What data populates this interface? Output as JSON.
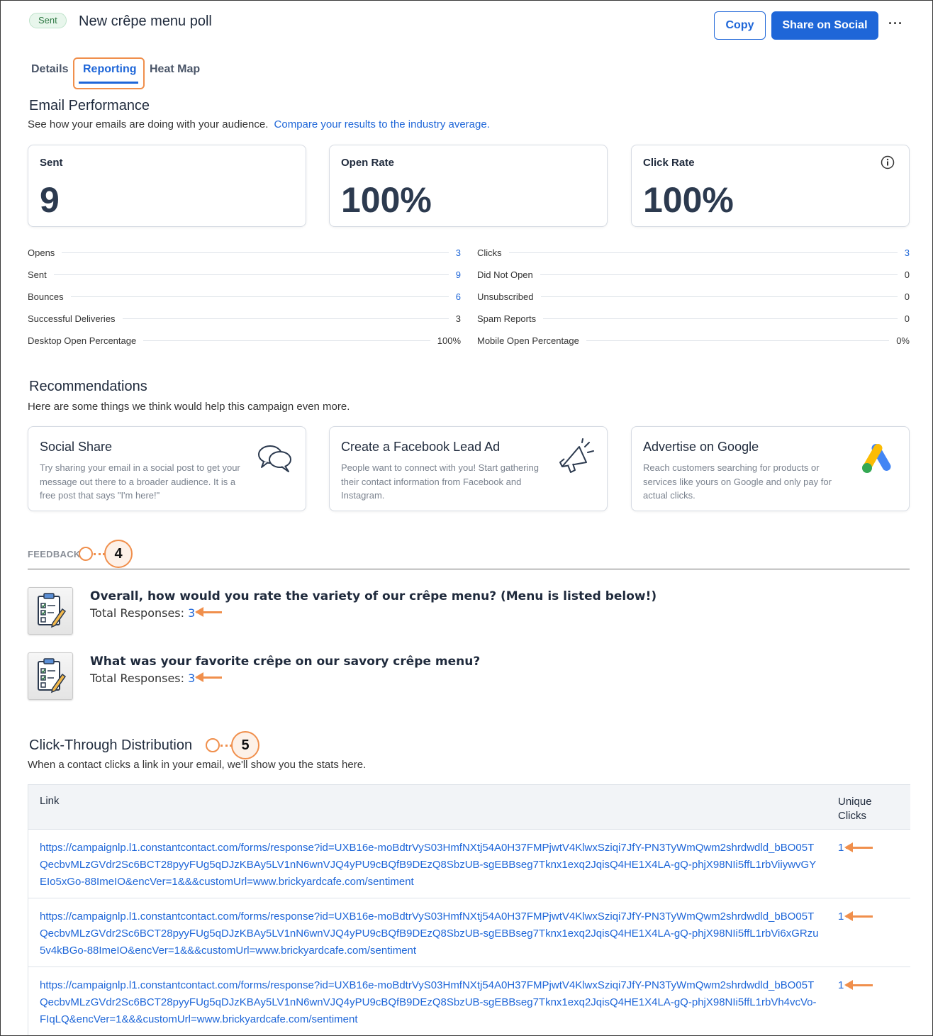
{
  "header": {
    "status_badge": "Sent",
    "title": "New crêpe menu poll",
    "copy_label": "Copy",
    "share_label": "Share on Social",
    "more_label": "···"
  },
  "tabs": [
    {
      "label": "Details"
    },
    {
      "label": "Reporting"
    },
    {
      "label": "Heat Map"
    }
  ],
  "performance": {
    "title": "Email Performance",
    "subtitle": "See how your emails are doing with your audience.",
    "compare_link": "Compare your results to the industry average.",
    "cards": [
      {
        "label": "Sent",
        "value": "9"
      },
      {
        "label": "Open Rate",
        "value": "100%"
      },
      {
        "label": "Click Rate",
        "value": "100%",
        "icon": "info-icon"
      }
    ],
    "left_stats": [
      {
        "name": "Opens",
        "value": "3",
        "link": true
      },
      {
        "name": "Sent",
        "value": "9",
        "link": true
      },
      {
        "name": "Bounces",
        "value": "6",
        "link": true
      },
      {
        "name": "Successful Deliveries",
        "value": "3",
        "link": false
      },
      {
        "name": "Desktop Open Percentage",
        "value": "100%",
        "link": false
      }
    ],
    "right_stats": [
      {
        "name": "Clicks",
        "value": "3",
        "link": true
      },
      {
        "name": "Did Not Open",
        "value": "0",
        "link": false
      },
      {
        "name": "Unsubscribed",
        "value": "0",
        "link": false
      },
      {
        "name": "Spam Reports",
        "value": "0",
        "link": false
      },
      {
        "name": "Mobile Open Percentage",
        "value": "0%",
        "link": false
      }
    ]
  },
  "recommendations": {
    "title": "Recommendations",
    "subtitle": "Here are some things we think would help this campaign even more.",
    "cards": [
      {
        "title": "Social Share",
        "desc": "Try sharing your email in a social post to get your message out there to a broader audience. It is a free post that says \"I'm here!\"",
        "icon": "chat-bubbles-icon"
      },
      {
        "title": "Create a Facebook Lead Ad",
        "desc": "People want to connect with you! Start gathering their contact information from Facebook and Instagram.",
        "icon": "megaphone-icon"
      },
      {
        "title": "Advertise on Google",
        "desc": "Reach customers searching for products or services like yours on Google and only pay for actual clicks.",
        "icon": "google-ads-icon"
      }
    ]
  },
  "feedback": {
    "label": "FEEDBACK",
    "callout": "4",
    "questions": [
      {
        "text": "Overall, how would you rate the variety of our crêpe menu? (Menu is listed below!)",
        "responses_label": "Total Responses:",
        "responses": "3"
      },
      {
        "text": "What was your favorite crêpe on our savory crêpe menu?",
        "responses_label": "Total Responses:",
        "responses": "3"
      }
    ]
  },
  "clickthrough": {
    "title": "Click-Through Distribution",
    "callout": "5",
    "subtitle": "When a contact clicks a link in your email, we'll show you the stats here.",
    "col_link": "Link",
    "col_clicks": "Unique Clicks",
    "rows": [
      {
        "url": "https://campaignlp.l1.constantcontact.com/forms/response?id=UXB16e-moBdtrVyS03HmfNXtj54A0H37FMPjwtV4KlwxSziqi7JfY-PN3TyWmQwm2shrdwdld_bBO05TQecbvMLzGVdr2Sc6BCT28pyyFUg5qDJzKBAy5LV1nN6wnVJQ4yPU9cBQfB9DEzQ8SbzUB-sgEBBseg7Tknx1exq2JqisQ4HE1X4LA-gQ-phjX98NIi5ffL1rbViiywvGYEIo5xGo-88ImeIO&encVer=1&&&customUrl=www.brickyardcafe.com/sentiment",
        "clicks": "1"
      },
      {
        "url": "https://campaignlp.l1.constantcontact.com/forms/response?id=UXB16e-moBdtrVyS03HmfNXtj54A0H37FMPjwtV4KlwxSziqi7JfY-PN3TyWmQwm2shrdwdld_bBO05TQecbvMLzGVdr2Sc6BCT28pyyFUg5qDJzKBAy5LV1nN6wnVJQ4yPU9cBQfB9DEzQ8SbzUB-sgEBBseg7Tknx1exq2JqisQ4HE1X4LA-gQ-phjX98NIi5ffL1rbVi6xGRzu5v4kBGo-88ImeIO&encVer=1&&&customUrl=www.brickyardcafe.com/sentiment",
        "clicks": "1"
      },
      {
        "url": "https://campaignlp.l1.constantcontact.com/forms/response?id=UXB16e-moBdtrVyS03HmfNXtj54A0H37FMPjwtV4KlwxSziqi7JfY-PN3TyWmQwm2shrdwdld_bBO05TQecbvMLzGVdr2Sc6BCT28pyyFUg5qDJzKBAy5LV1nN6wnVJQ4yPU9cBQfB9DEzQ8SbzUB-sgEBBseg7Tknx1exq2JqisQ4HE1X4LA-gQ-phjX98NIi5ffL1rbVh4vcVo-FIqLQ&encVer=1&&&customUrl=www.brickyardcafe.com/sentiment",
        "clicks": "1"
      }
    ]
  },
  "colors": {
    "primary": "#1e66d8",
    "callout": "#f08f4c",
    "badge_bg": "#e8f6ec"
  }
}
